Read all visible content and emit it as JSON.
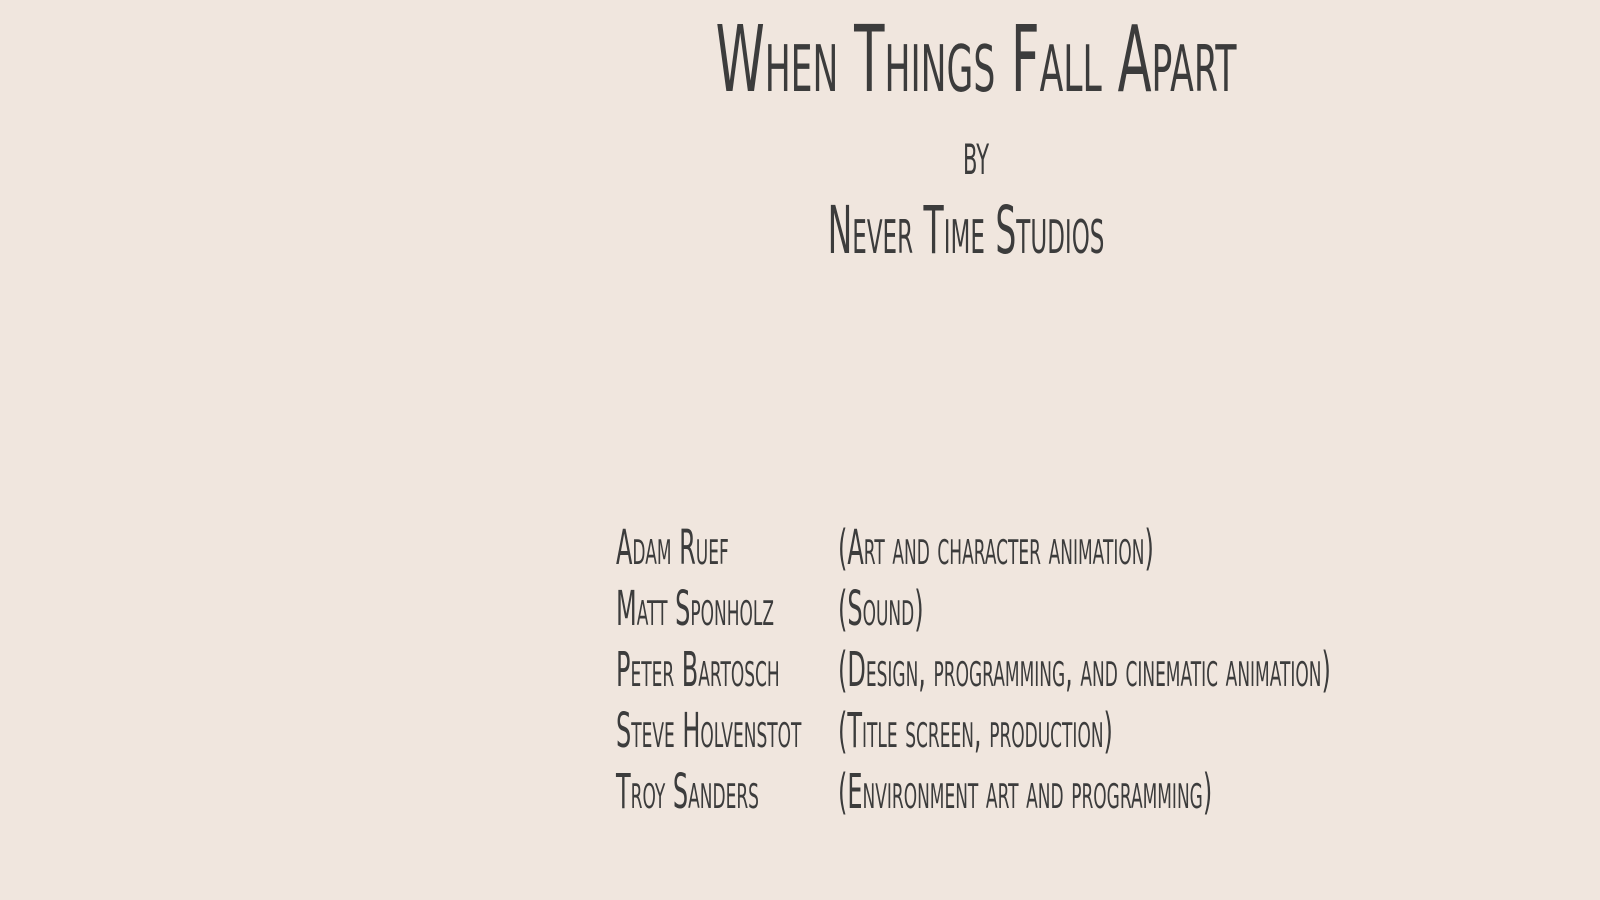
{
  "title_screen": {
    "title": "When Things Fall Apart",
    "by": "by",
    "studio": "Never Time Studios"
  },
  "credits": [
    {
      "name": "Adam Ruef",
      "role": "(Art and character animation)"
    },
    {
      "name": "Matt Sponholz",
      "role": "(Sound)"
    },
    {
      "name": "Peter Bartosch",
      "role": "(Design, programming, and cinematic animation)"
    },
    {
      "name": "Steve Holvenstot",
      "role": "(Title screen, production)"
    },
    {
      "name": "Troy Sanders",
      "role": "(Environment art and programming)"
    }
  ],
  "colors": {
    "background": "#f0e6de",
    "text": "#3c3c3c"
  }
}
